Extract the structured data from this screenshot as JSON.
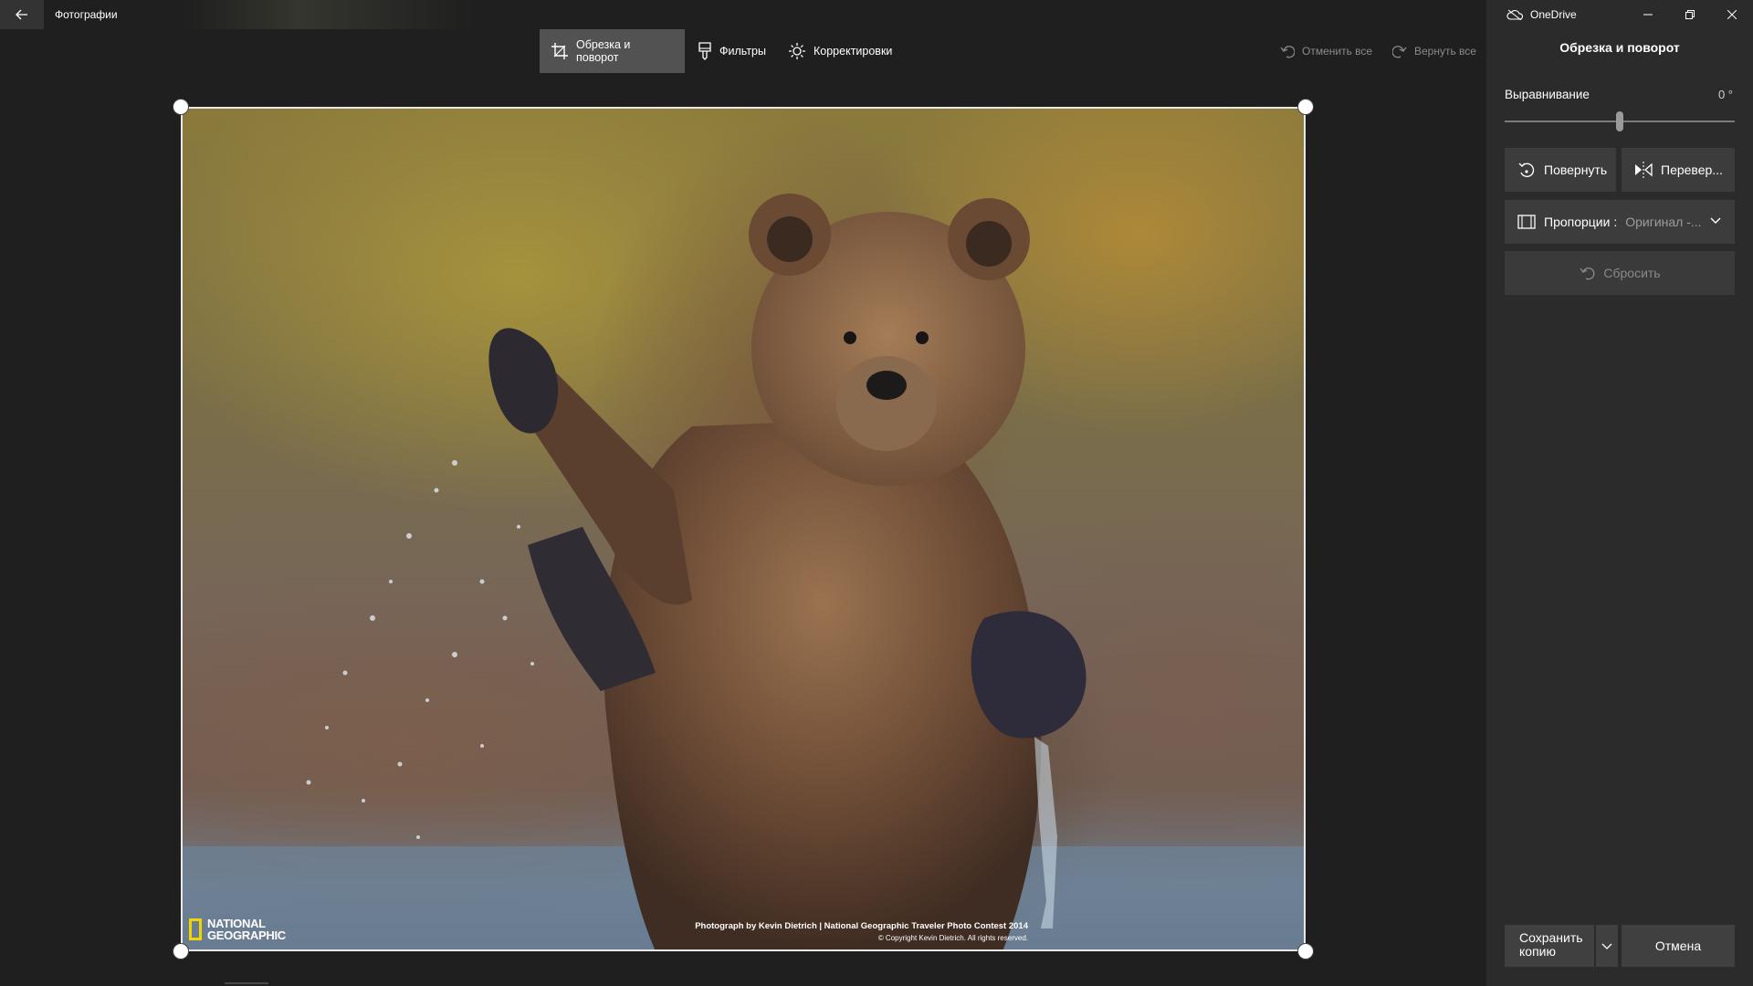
{
  "app": {
    "title": "Фотографии"
  },
  "toolbar": {
    "crop_label": "Обрезка и поворот",
    "filters_label": "Фильтры",
    "adjust_label": "Корректировки",
    "undo_all": "Отменить все",
    "redo_all": "Вернуть все"
  },
  "photo": {
    "logo_text": "NATIONAL\nGEOGRAPHIC",
    "credit_line1": "Photograph by Kevin  Dietrich | National Geographic Traveler Photo Contest 2014",
    "credit_line2": "© Copyright Kevin  Dietrich. All rights reserved."
  },
  "panel": {
    "account": "OneDrive",
    "title": "Обрезка и поворот",
    "straighten_label": "Выравнивание",
    "straighten_value": "0 °",
    "straighten_level": 0.5,
    "rotate_label": "Повернуть",
    "flip_label": "Перевер...",
    "aspect_label": "Пропорции :",
    "aspect_value": "Оригинал -...",
    "reset_label": "Сбросить",
    "save_label": "Сохранить копию",
    "cancel_label": "Отмена"
  },
  "colors": {
    "background": "#1f1f1f",
    "panel": "#2b2b2b",
    "active_tab": "#525252",
    "button": "#3c3c3c",
    "ng_yellow": "#f2d400"
  },
  "icons": [
    "back-arrow-icon",
    "crop-icon",
    "filter-icon",
    "sun-icon",
    "undo-icon",
    "redo-icon",
    "onedrive-icon",
    "minimize-icon",
    "restore-icon",
    "close-icon",
    "rotate-icon",
    "flip-icon",
    "aspect-ratio-icon",
    "chevron-down-icon",
    "reset-icon"
  ]
}
